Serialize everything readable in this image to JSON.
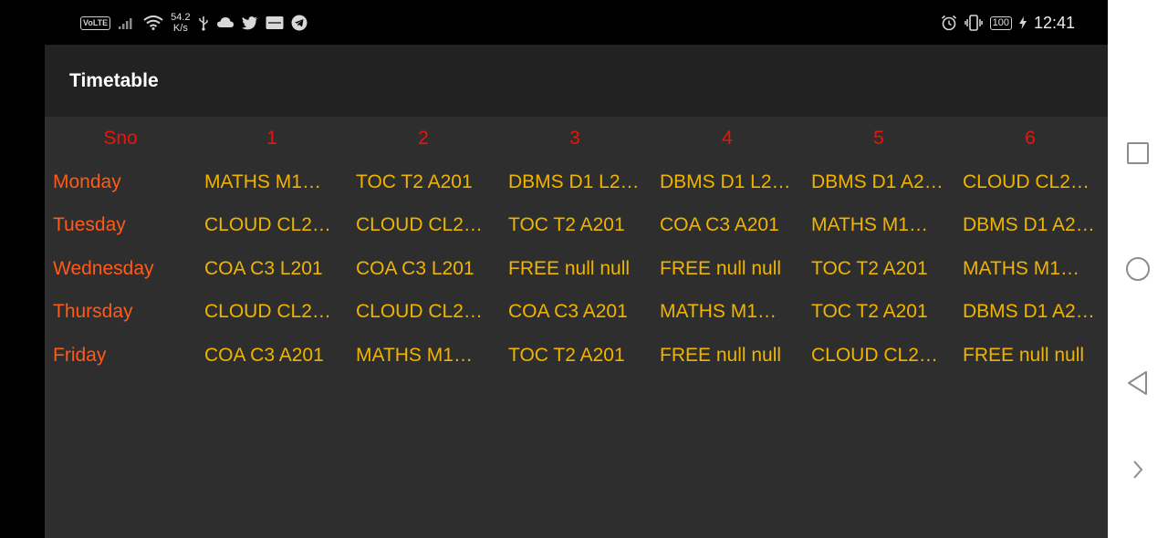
{
  "status_bar": {
    "network_badge": "VoLTE",
    "speed_value": "54.2",
    "speed_unit": "K/s",
    "battery": "100",
    "time": "12:41",
    "icons_left": [
      "volte-badge",
      "signal-icon",
      "wifi-icon",
      "usb-icon",
      "cloud-icon",
      "twitter-icon",
      "app-badge-icon",
      "telegram-icon"
    ],
    "icons_right": [
      "alarm-icon",
      "vibrate-icon",
      "battery-icon",
      "charging-icon"
    ]
  },
  "app_bar": {
    "title": "Timetable"
  },
  "timetable": {
    "headers": [
      "Sno",
      "1",
      "2",
      "3",
      "4",
      "5",
      "6"
    ],
    "rows": [
      {
        "day": "Monday",
        "slots": [
          "MATHS M1…",
          "TOC T2 A201",
          "DBMS D1 L2…",
          "DBMS D1 L2…",
          "DBMS D1 A2…",
          "CLOUD CL2…"
        ]
      },
      {
        "day": "Tuesday",
        "slots": [
          "CLOUD CL2…",
          "CLOUD CL2…",
          "TOC T2 A201",
          "COA C3 A201",
          "MATHS M1…",
          "DBMS D1 A2…"
        ]
      },
      {
        "day": "Wednesday",
        "slots": [
          "COA C3 L201",
          "COA C3 L201",
          "FREE null null",
          "FREE null null",
          "TOC T2 A201",
          "MATHS M1…"
        ]
      },
      {
        "day": "Thursday",
        "slots": [
          "CLOUD CL2…",
          "CLOUD CL2…",
          "COA C3 A201",
          "MATHS M1…",
          "TOC T2 A201",
          "DBMS D1 A2…"
        ]
      },
      {
        "day": "Friday",
        "slots": [
          "COA C3 A201",
          "MATHS M1…",
          "TOC T2 A201",
          "FREE null null",
          "CLOUD CL2…",
          "FREE null null"
        ]
      }
    ]
  },
  "colors": {
    "header_text": "#e8150c",
    "day_text": "#ff5a1a",
    "slot_text": "#f0b400",
    "app_bg": "#2e2e2e",
    "appbar_bg": "#222222"
  },
  "nav_bar": {
    "buttons": [
      "recents-square-icon",
      "home-circle-icon",
      "back-triangle-icon",
      "expand-chevron-icon"
    ]
  }
}
